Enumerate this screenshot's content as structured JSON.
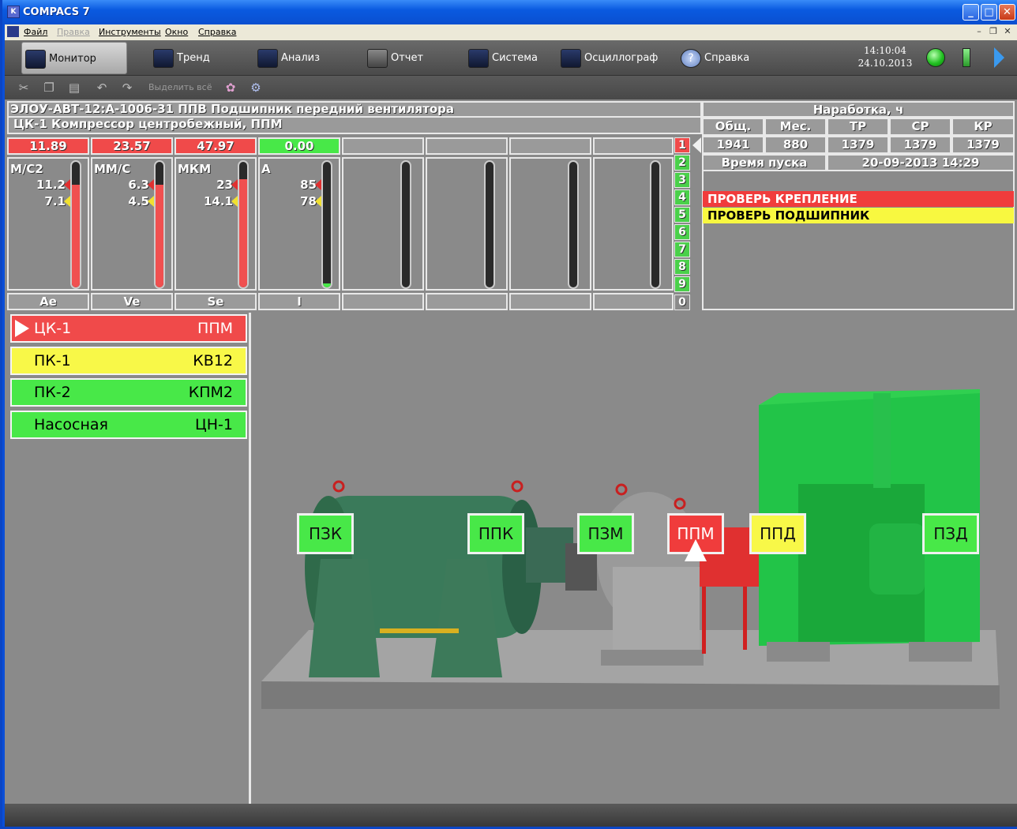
{
  "window": {
    "title": "COMPACS 7",
    "icon_text": "K"
  },
  "menu": {
    "items": [
      "Файл",
      "Правка",
      "Инструменты",
      "Окно",
      "Справка"
    ]
  },
  "nav": {
    "items": [
      {
        "label": "Монитор",
        "icon": "monitor-icon"
      },
      {
        "label": "Тренд",
        "icon": "trend-icon"
      },
      {
        "label": "Анализ",
        "icon": "analysis-icon"
      },
      {
        "label": "Отчет",
        "icon": "report-icon"
      },
      {
        "label": "Система",
        "icon": "system-icon"
      },
      {
        "label": "Осциллограф",
        "icon": "oscilloscope-icon"
      },
      {
        "label": "Справка",
        "icon": "help-icon"
      }
    ],
    "time": "14:10:04",
    "date": "24.10.2013"
  },
  "toolbar": {
    "select_all": "Выделить всё"
  },
  "header": {
    "line1": "ЭЛОУ-АВТ-12:А-1006-31 ППВ Подшипник передний вентилятора",
    "line2": "ЦК-1 Компрессор центробежный, ППМ"
  },
  "runtime": {
    "title": "Наработка, ч",
    "columns": [
      "Общ.",
      "Мес.",
      "ТР",
      "СР",
      "КР"
    ],
    "values": [
      "1941",
      "880",
      "1379",
      "1379",
      "1379"
    ],
    "start_label": "Время пуска",
    "start_value": "20-09-2013  14:29"
  },
  "gauges": [
    {
      "value": "11.89",
      "status": "alarm",
      "unit": "М/С2",
      "t1": "11.2",
      "t2": "7.1",
      "label": "Ae",
      "level": 0.82
    },
    {
      "value": "23.57",
      "status": "alarm",
      "unit": "ММ/С",
      "t1": "6.3",
      "t2": "4.5",
      "label": "Ve",
      "level": 0.82
    },
    {
      "value": "47.97",
      "status": "alarm",
      "unit": "МКМ",
      "t1": "23",
      "t2": "14.1",
      "label": "Se",
      "level": 0.86
    },
    {
      "value": "0.00",
      "status": "ok",
      "unit": "А",
      "t1": "85",
      "t2": "78",
      "label": "I",
      "level": 0.03
    }
  ],
  "channels": [
    "1",
    "2",
    "3",
    "4",
    "5",
    "6",
    "7",
    "8",
    "9",
    "0"
  ],
  "alarms": [
    {
      "text": "ПРОВЕРЬ КРЕПЛЕНИЕ",
      "color": "#f03c3c"
    },
    {
      "text": "ПРОВЕРЬ ПОДШИПНИК",
      "color": "#f8f840"
    }
  ],
  "equipment": [
    {
      "name": "ЦК-1",
      "code": "ППМ",
      "color": "#f04a4a",
      "selected": true
    },
    {
      "name": "ПК-1",
      "code": "КВ12",
      "color": "#f8f848"
    },
    {
      "name": "ПК-2",
      "code": "КПМ2",
      "color": "#48e848"
    },
    {
      "name": "Насосная",
      "code": "ЦН-1",
      "color": "#48e848"
    }
  ],
  "points": [
    {
      "label": "ПЗК",
      "color": "#48e848"
    },
    {
      "label": "ППК",
      "color": "#48e848"
    },
    {
      "label": "ПЗМ",
      "color": "#48e848"
    },
    {
      "label": "ППМ",
      "color": "#f03c3c"
    },
    {
      "label": "ППД",
      "color": "#f8f848"
    },
    {
      "label": "ПЗД",
      "color": "#48e848"
    }
  ],
  "colors": {
    "alarm": "#f04a4a",
    "ok": "#48e848",
    "warn": "#f8f848",
    "panel": "#8a8a8a"
  }
}
